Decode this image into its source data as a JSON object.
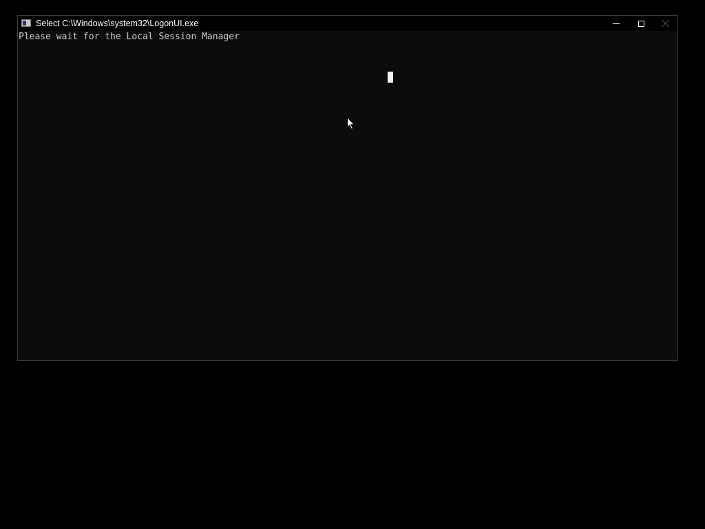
{
  "window": {
    "title": "Select C:\\Windows\\system32\\LogonUI.exe",
    "icon": "console-app-icon",
    "controls": {
      "minimize_icon": "minimize-icon",
      "maximize_icon": "maximize-icon",
      "close_icon": "close-icon"
    }
  },
  "console": {
    "lines": [
      "Please wait for the Local Session Manager"
    ],
    "cursor": "block-cursor"
  },
  "colors": {
    "desktop_bg": "#000000",
    "console_bg": "#0c0c0c",
    "console_text": "#cccccc",
    "title_text": "#ffffff"
  },
  "pointer": "arrow-pointer-icon"
}
